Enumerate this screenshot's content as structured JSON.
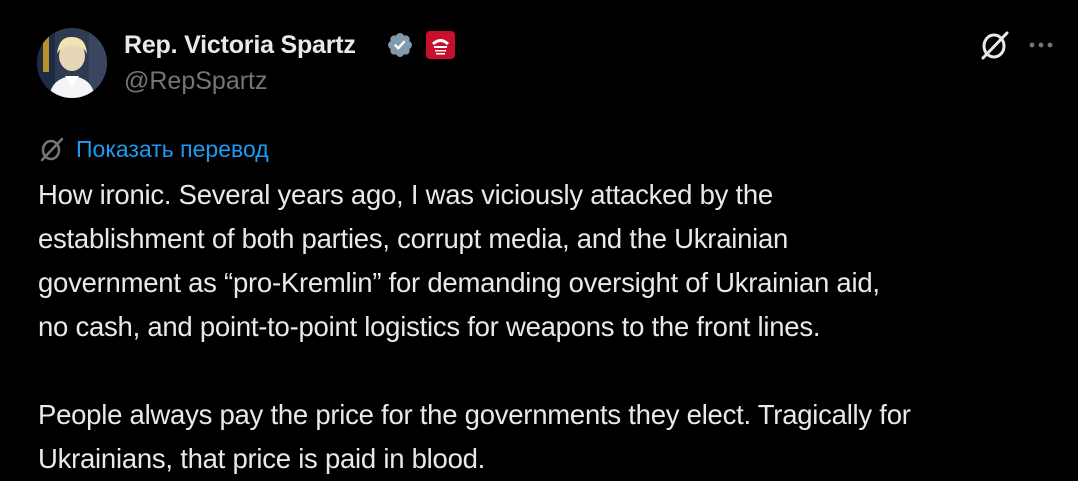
{
  "author": {
    "name": "Rep. Victoria Spartz",
    "handle": "@RepSpartz",
    "avatar": "avatar",
    "verified_icon": "verified-badge-icon",
    "affiliate_icon": "affiliate-badge-icon"
  },
  "actions": {
    "grok_icon": "grok-icon",
    "more_icon": "more-options-icon"
  },
  "translate": {
    "icon": "grok-icon",
    "label": "Показать перевод"
  },
  "tweet": {
    "lines": [
      "How ironic. Several years ago, I was viciously attacked by the",
      "establishment of both parties, corrupt media, and the Ukrainian",
      "government as “pro-Kremlin” for demanding oversight of Ukrainian aid,",
      "no cash, and point-to-point logistics for weapons to the front lines.",
      "",
      "People always pay the price for the governments they elect. Tragically for",
      "Ukrainians, that price is paid in blood."
    ]
  },
  "colors": {
    "background": "#000000",
    "text": "#e7e9ea",
    "muted": "#71767b",
    "link": "#1d9bf0",
    "verified_badge": "#829aab",
    "affiliate_badge": "#c8102e"
  }
}
